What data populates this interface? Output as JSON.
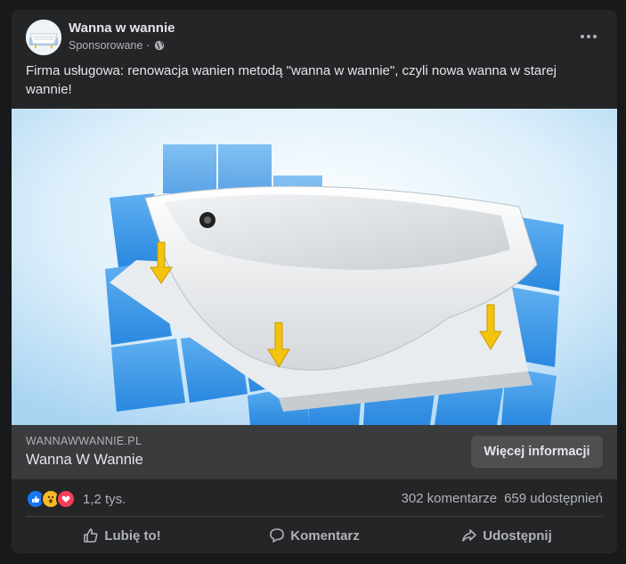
{
  "post": {
    "page_name": "Wanna w wannie",
    "sponsored_label": "Sponsorowane",
    "separator": "·",
    "more_icon": "more-horizontal-icon",
    "text": "Firma usługowa: renowacja wanien metodą \"wanna w wannie\", czyli nowa wanna w starej wannie!"
  },
  "link": {
    "domain": "WANNAWWANNIE.PL",
    "title": "Wanna W Wannie",
    "cta_label": "Więcej informacji"
  },
  "stats": {
    "reactions": [
      "like-icon",
      "wow-icon",
      "love-icon"
    ],
    "reaction_count": "1,2 tys.",
    "comments": "302 komentarze",
    "shares": "659 udostępnień"
  },
  "actions": {
    "like": "Lubię to!",
    "comment": "Komentarz",
    "share": "Udostępnij"
  },
  "colors": {
    "background": "#18191a",
    "card": "#242526",
    "link_bar": "#3a3b3c",
    "button": "#4e4f50",
    "text_primary": "#e4e6eb",
    "text_secondary": "#b0b3b8",
    "like_blue": "#1877f2",
    "love_red": "#f33e58",
    "wow_yellow": "#f7b928"
  }
}
